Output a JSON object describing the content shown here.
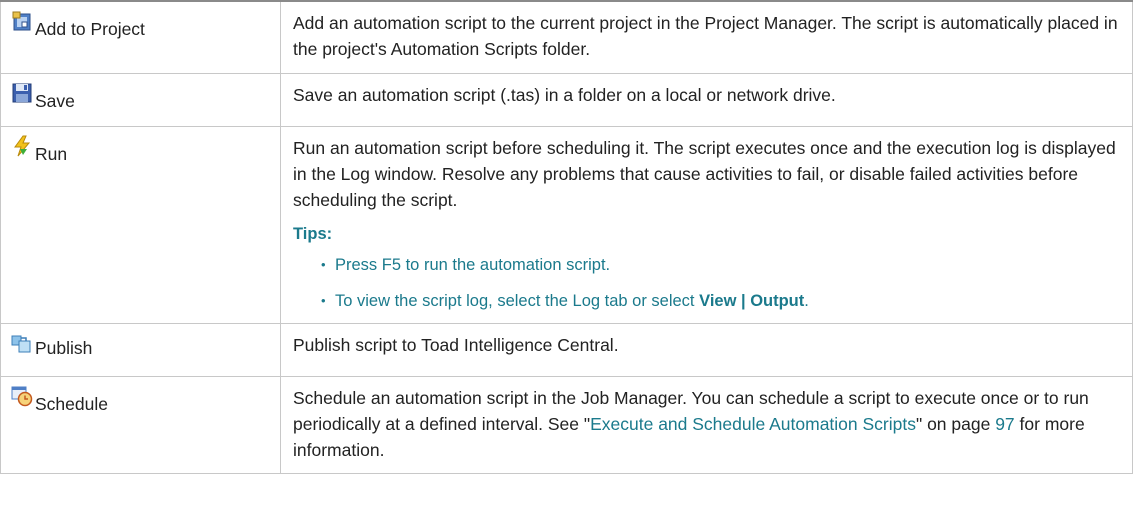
{
  "rows": [
    {
      "command": "Add to Project",
      "icon": "add-to-project-icon",
      "description": "Add an automation script to the current project in the Project Manager. The script is automatically placed in the project's Automation Scripts folder."
    },
    {
      "command": "Save",
      "icon": "save-floppy-icon",
      "description": "Save an automation script (.tas) in a folder on a local or network drive."
    },
    {
      "command": "Run",
      "icon": "run-lightning-icon",
      "description": "Run an automation script before scheduling it. The script executes once and the execution log is displayed in the Log window. Resolve any problems that cause activities to fail, or disable failed activities before scheduling the script.",
      "tips_heading": "Tips:",
      "tip1": "Press F5 to run the automation script.",
      "tip2_prefix": "To view the script log, select the Log tab or select ",
      "tip2_bold": "View | Output",
      "tip2_suffix": "."
    },
    {
      "command": "Publish",
      "icon": "publish-icon",
      "description": "Publish script to Toad Intelligence Central."
    },
    {
      "command": "Schedule",
      "icon": "schedule-clock-icon",
      "description_prefix": "Schedule an automation script in the Job Manager. You can schedule a script to execute once or to run periodically at a defined interval. See \"",
      "link_text": "Execute and Schedule Automation Scripts",
      "description_mid": "\" on page ",
      "page_number": "97",
      "description_suffix": " for more information."
    }
  ],
  "colors": {
    "accent": "#1b7a8c",
    "border": "#c8c8c8",
    "text": "#222222"
  }
}
